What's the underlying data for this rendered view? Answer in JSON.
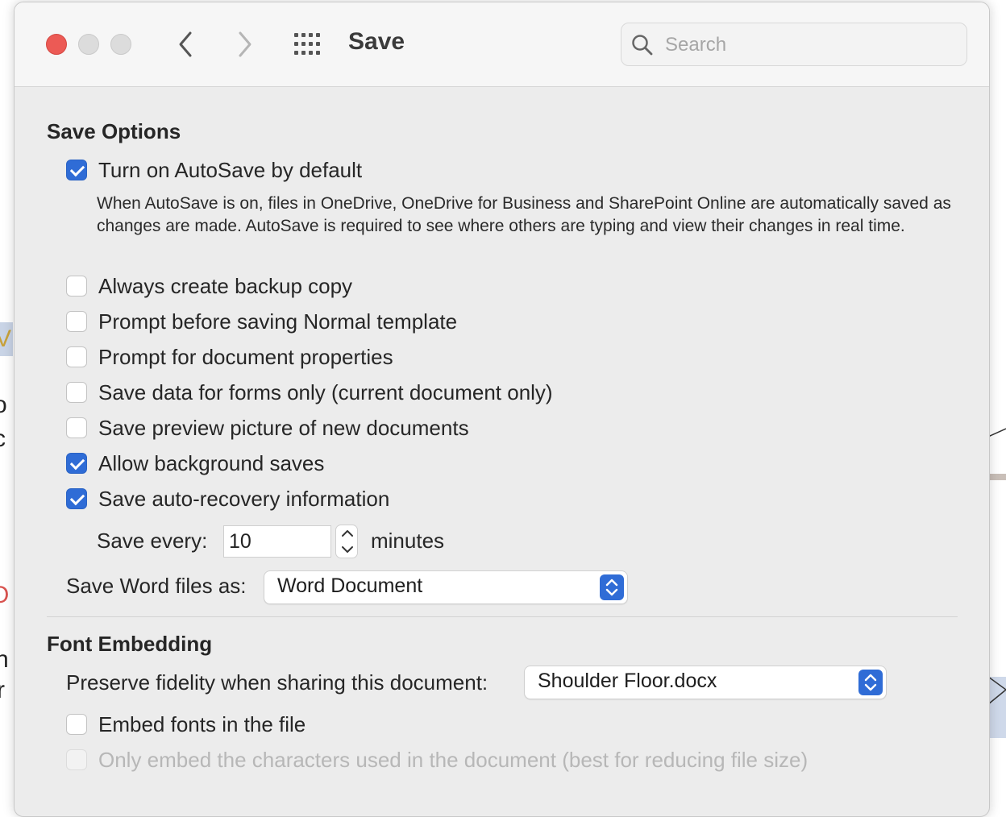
{
  "window": {
    "title": "Save"
  },
  "search": {
    "placeholder": "Search",
    "value": ""
  },
  "save_options": {
    "heading": "Save Options",
    "autosave": {
      "label": "Turn on AutoSave by default",
      "checked": true,
      "description": "When AutoSave is on, files in OneDrive, OneDrive for Business and SharePoint Online are automatically saved as changes are made. AutoSave is required to see where others are typing and view their changes in real time."
    },
    "options": [
      {
        "label": "Always create backup copy",
        "checked": false
      },
      {
        "label": "Prompt before saving Normal template",
        "checked": false
      },
      {
        "label": "Prompt for document properties",
        "checked": false
      },
      {
        "label": "Save data for forms only (current document only)",
        "checked": false
      },
      {
        "label": "Save preview picture of new documents",
        "checked": false
      },
      {
        "label": "Allow background saves",
        "checked": true
      },
      {
        "label": "Save auto-recovery information",
        "checked": true
      }
    ],
    "save_every": {
      "label": "Save every:",
      "value": "10",
      "unit": "minutes"
    },
    "save_as": {
      "label": "Save Word files as:",
      "value": "Word Document"
    }
  },
  "font_embedding": {
    "heading": "Font Embedding",
    "preserve": {
      "label": "Preserve fidelity when sharing this document:",
      "value": "Shoulder Floor.docx"
    },
    "embed_fonts": {
      "label": "Embed fonts in the file",
      "checked": false
    },
    "only_used_chars": {
      "label": "Only embed the characters used in the document (best for reducing file size)",
      "checked": false,
      "disabled": true
    }
  },
  "background_fragments": [
    "V",
    "o",
    "c",
    "O",
    "n",
    "r"
  ],
  "colors": {
    "accent": "#2f6cd6",
    "close": "#ec5a55",
    "window_bg": "#ececec",
    "titlebar_bg": "#f6f6f6"
  }
}
